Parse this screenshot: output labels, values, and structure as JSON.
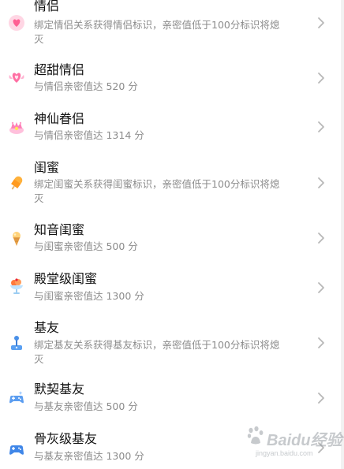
{
  "items": [
    {
      "title": "情侣",
      "sub_line1": "绑定情侣关系获得情侣标识，亲密值低于100分标识将熄",
      "sub_line2": "灭",
      "icon": "pink-heart-badge-icon"
    },
    {
      "title": "超甜情侣",
      "sub_line1": "与情侣亲密值达 520 分",
      "icon": "winged-heart-icon"
    },
    {
      "title": "神仙眷侣",
      "sub_line1": "与情侣亲密值达 1314 分",
      "icon": "heart-crown-icon"
    },
    {
      "title": "闺蜜",
      "sub_line1": "绑定闺蜜关系获得闺蜜标识，亲密值低于100分标识将熄",
      "sub_line2": "灭",
      "icon": "popsicle-icon"
    },
    {
      "title": "知音闺蜜",
      "sub_line1": "与闺蜜亲密值达 500 分",
      "icon": "ice-cream-cone-icon"
    },
    {
      "title": "殿堂级闺蜜",
      "sub_line1": "与闺蜜亲密值达 1300 分",
      "icon": "sundae-icon"
    },
    {
      "title": "基友",
      "sub_line1": "绑定基友关系获得基友标识，亲密值低于100分标识将熄",
      "sub_line2": "灭",
      "icon": "joystick-icon"
    },
    {
      "title": "默契基友",
      "sub_line1": "与基友亲密值达 500 分",
      "icon": "gamepad-sparkle-icon"
    },
    {
      "title": "骨灰级基友",
      "sub_line1": "与基友亲密值达 1300 分",
      "icon": "gamepad-icon"
    }
  ],
  "watermark": {
    "brand": "Baidu经验",
    "url": "jingyan.baidu.com"
  }
}
